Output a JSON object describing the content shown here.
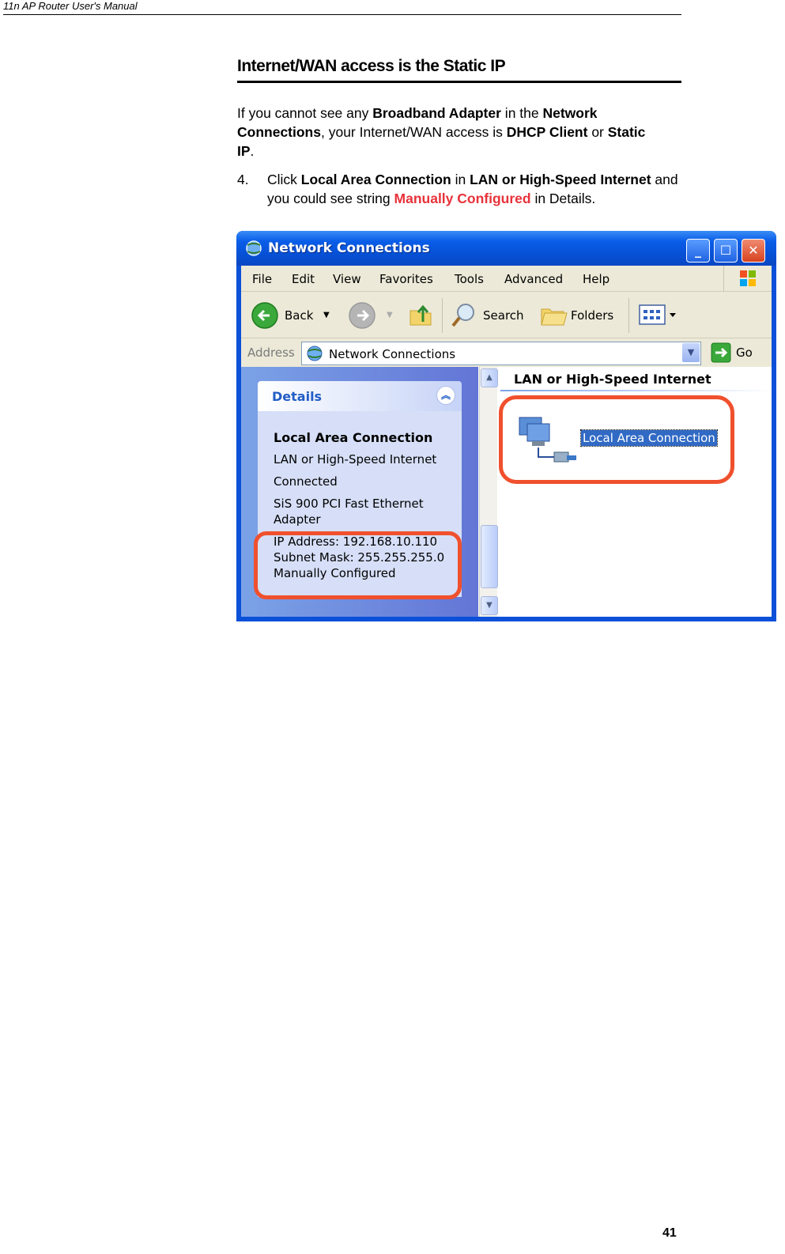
{
  "header": {
    "text": "11n AP Router User's Manual"
  },
  "section": {
    "title": "Internet/WAN access is the Static IP"
  },
  "para": {
    "t1": "If you cannot see any ",
    "b1": "Broadband Adapter",
    "t2": " in the ",
    "b2": "Network Connections",
    "t3": ", your Internet/WAN access is ",
    "b3": "DHCP Client",
    "t4": " or ",
    "b4": "Static IP",
    "t5": "."
  },
  "step": {
    "number": "4.",
    "t1": "Click ",
    "b1": "Local Area Connection",
    "t2": " in ",
    "b2": "LAN or High-Speed Internet",
    "t3": " and you could see string ",
    "red": "Manually Configured",
    "t4": " in Details."
  },
  "window": {
    "title": "Network Connections",
    "menu": [
      "File",
      "Edit",
      "View",
      "Favorites",
      "Tools",
      "Advanced",
      "Help"
    ],
    "toolbar": {
      "back": "Back",
      "search": "Search",
      "folders": "Folders"
    },
    "address": {
      "label": "Address",
      "value": "Network Connections",
      "go": "Go"
    },
    "details": {
      "title": "Details",
      "name": "Local Area Connection",
      "type": "LAN or High-Speed Internet",
      "status": "Connected",
      "adapter_line1": "SiS 900 PCI Fast Ethernet",
      "adapter_line2": "Adapter",
      "ip": "IP Address: 192.168.10.110",
      "mask": "Subnet Mask: 255.255.255.0",
      "config": "Manually Configured"
    },
    "group_title": "LAN or High-Speed Internet",
    "connection_label": "Local Area Connection"
  },
  "colors": {
    "highlight_red": "#e8323a",
    "xp_blue": "#0a50d8",
    "oval": "#f0502d"
  },
  "page_number": "41"
}
